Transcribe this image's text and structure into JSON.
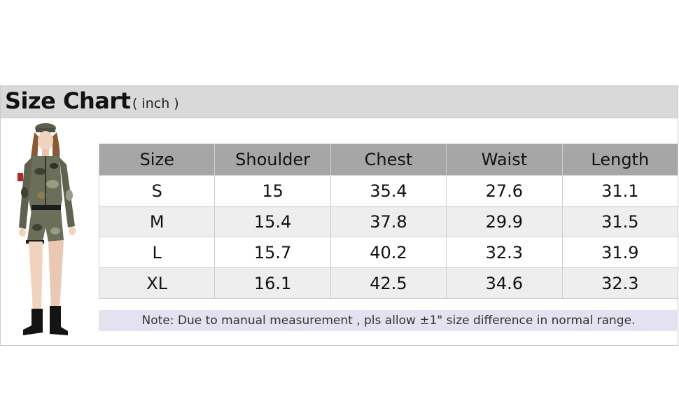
{
  "header": {
    "title": "Size Chart",
    "unit": "( inch )"
  },
  "table": {
    "columns": [
      "Size",
      "Shoulder",
      "Chest",
      "Waist",
      "Length"
    ],
    "rows": [
      [
        "S",
        "15",
        "35.4",
        "27.6",
        "31.1"
      ],
      [
        "M",
        "15.4",
        "37.8",
        "29.9",
        "31.5"
      ],
      [
        "L",
        "15.7",
        "40.2",
        "32.3",
        "31.9"
      ],
      [
        "XL",
        "16.1",
        "42.5",
        "34.6",
        "32.3"
      ]
    ]
  },
  "note": "Note: Due to manual measurement , pls allow ±1\" size difference in normal range.",
  "colors": {
    "title_bar": "#d9d9d9",
    "header_row": "#a6a6a6",
    "alt_row": "#eeeeee",
    "note_bg": "#e4e2f0"
  }
}
